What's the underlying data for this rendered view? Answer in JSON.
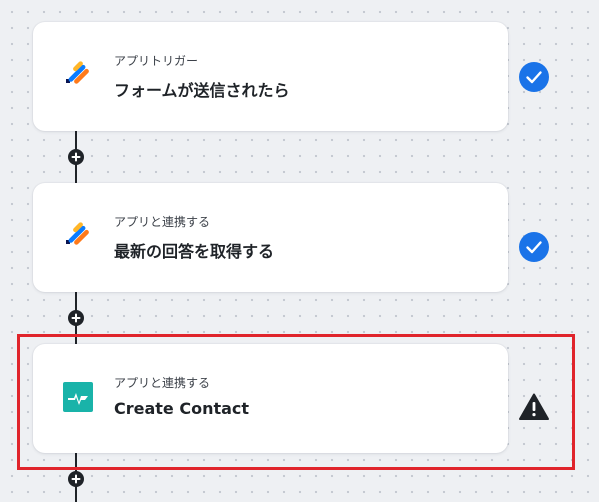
{
  "flow": {
    "steps": [
      {
        "subtitle": "アプリトリガー",
        "title": "フォームが送信されたら",
        "icon": "jotform-icon",
        "status": "completed"
      },
      {
        "subtitle": "アプリと連携する",
        "title": "最新の回答を取得する",
        "icon": "jotform-icon",
        "status": "completed"
      },
      {
        "subtitle": "アプリと連携する",
        "title": "Create Contact",
        "icon": "hubspot-style-app-icon",
        "status": "warning"
      }
    ]
  },
  "colors": {
    "check_badge": "#1a73e8",
    "warning": "#1f2328",
    "highlight_border": "#e0242b",
    "app_icon_teal": "#19b3a9",
    "jotform_orange": "#ff7a1a",
    "jotform_blue": "#0a7cff",
    "jotform_navy": "#0a1551"
  }
}
